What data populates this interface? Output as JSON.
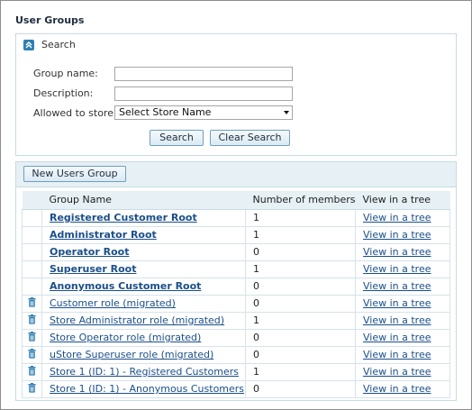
{
  "page": {
    "title": "User Groups"
  },
  "search": {
    "title": "Search",
    "group_name_label": "Group name:",
    "group_name_value": "",
    "description_label": "Description:",
    "description_value": "",
    "store_label": "Allowed to store:",
    "store_selected": "Select Store Name",
    "search_button": "Search",
    "clear_button": "Clear Search"
  },
  "groups": {
    "new_button": "New Users Group",
    "columns": [
      "Group Name",
      "Number of members",
      "View in a tree"
    ],
    "rows": [
      {
        "name": "Registered Customer Root",
        "members": "1",
        "view": "View in a tree",
        "bold": true,
        "deletable": false
      },
      {
        "name": "Administrator Root",
        "members": "1",
        "view": "View in a tree",
        "bold": true,
        "deletable": false
      },
      {
        "name": "Operator Root",
        "members": "0",
        "view": "View in a tree",
        "bold": true,
        "deletable": false
      },
      {
        "name": "Superuser Root",
        "members": "1",
        "view": "View in a tree",
        "bold": true,
        "deletable": false
      },
      {
        "name": "Anonymous Customer Root",
        "members": "0",
        "view": "View in a tree",
        "bold": true,
        "deletable": false
      },
      {
        "name": "Customer role (migrated)",
        "members": "0",
        "view": "View in a tree",
        "bold": false,
        "deletable": true
      },
      {
        "name": "Store Administrator role (migrated)",
        "members": "1",
        "view": "View in a tree",
        "bold": false,
        "deletable": true
      },
      {
        "name": "Store Operator role (migrated)",
        "members": "0",
        "view": "View in a tree",
        "bold": false,
        "deletable": true
      },
      {
        "name": "uStore Superuser role (migrated)",
        "members": "0",
        "view": "View in a tree",
        "bold": false,
        "deletable": true
      },
      {
        "name": "Store 1 (ID: 1) - Registered Customers",
        "members": "1",
        "view": "View in a tree",
        "bold": false,
        "deletable": true
      },
      {
        "name": "Store 1 (ID: 1) - Anonymous Customers",
        "members": "0",
        "view": "View in a tree",
        "bold": false,
        "deletable": true
      }
    ]
  },
  "colors": {
    "accent": "#2f7fb3",
    "link": "#1a4f8a",
    "panel_border": "#c7dbe3",
    "header_bg": "#e6f0f5"
  },
  "icons": {
    "collapse": "chevron-up-icon",
    "delete": "trash-icon"
  }
}
